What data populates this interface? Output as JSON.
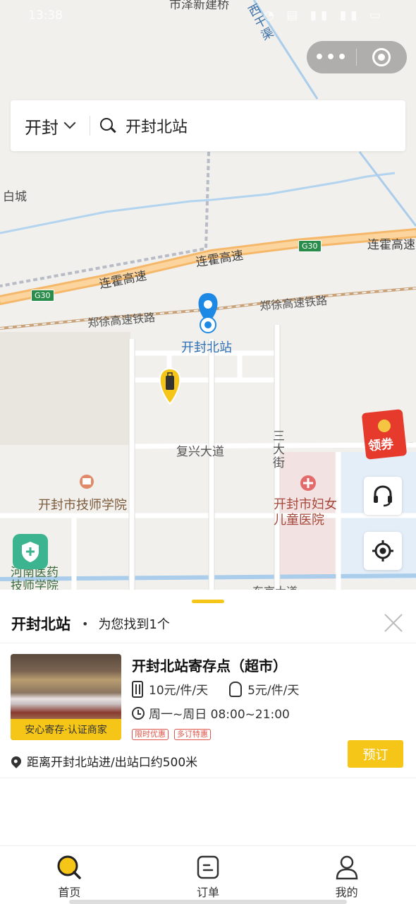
{
  "status_bar": {
    "time": "13:38",
    "indicators": "◔ ▤ ▮▮ ▮▮ ▭"
  },
  "capsule": {
    "more_label": "•••",
    "close_icon": "target-circle-icon"
  },
  "search": {
    "city": "开封",
    "query": "开封北站",
    "icon": "search-icon"
  },
  "map": {
    "labels": {
      "top_partial": "市泽新建桥",
      "canal": "西干渠",
      "baicheng": "白城",
      "highway_1": "连霍高速",
      "highway_2": "连霍高速",
      "highway_3": "连霍高速",
      "g30_a": "G30",
      "g30_b": "G30",
      "railway_1": "郑徐高速铁路",
      "railway_2": "郑徐高速铁路",
      "station": "开封北站",
      "fuxing": "复兴大道",
      "sanda": "三大街",
      "school": "开封市技师学院",
      "hospital": "开封市妇女儿童医院",
      "henan_school": "河南医药技师学院",
      "dongjing": "东京大道"
    },
    "coupon_label": "领券",
    "colors": {
      "road_orange": "#f5b86a",
      "water": "#a9cdea",
      "rail": "#c9a27a",
      "marker_blue": "#1e88e5",
      "marker_yellow": "#f5c518"
    }
  },
  "sheet": {
    "title": "开封北站",
    "bullet": "•",
    "found_text": "为您找到1个",
    "store": {
      "name": "开封北站寄存点（超市）",
      "badge": "安心寄存·认证商家",
      "price_large": "10元/件/天",
      "price_small": "5元/件/天",
      "hours": "周一~周日 08:00~21:00",
      "tags": [
        "限时优惠",
        "多订特惠"
      ],
      "distance": "距离开封北站进/出站口约500米",
      "book_label": "预订"
    }
  },
  "tabbar": {
    "tabs": [
      {
        "label": "首页",
        "icon": "search-icon",
        "active": true
      },
      {
        "label": "订单",
        "icon": "order-icon",
        "active": false
      },
      {
        "label": "我的",
        "icon": "user-icon",
        "active": false
      }
    ]
  },
  "accent_color": "#f5c518"
}
